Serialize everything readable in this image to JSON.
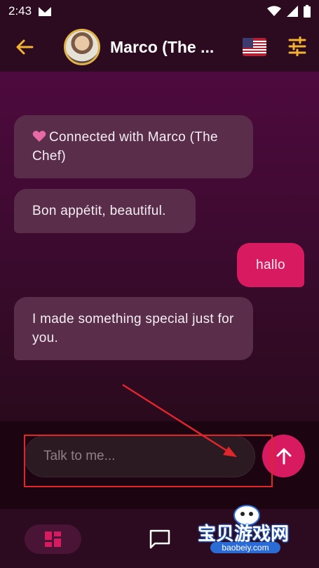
{
  "status_bar": {
    "time": "2:43"
  },
  "header": {
    "title": "Marco (The ...",
    "flag_label": "🇺🇸"
  },
  "messages": [
    {
      "direction": "in",
      "text": "Connected with Marco (The Chef)",
      "has_heart": true
    },
    {
      "direction": "in",
      "text": "Bon appétit, beautiful."
    },
    {
      "direction": "out",
      "text": "hallo"
    },
    {
      "direction": "in",
      "text": "I made something special just for you."
    }
  ],
  "composer": {
    "placeholder": "Talk to me..."
  },
  "watermark": {
    "text": "宝贝游戏网",
    "url": "baobeiy.com"
  },
  "colors": {
    "accent": "#d81b60",
    "icon_gold": "#f2b233",
    "annotation_red": "#e0262d"
  }
}
